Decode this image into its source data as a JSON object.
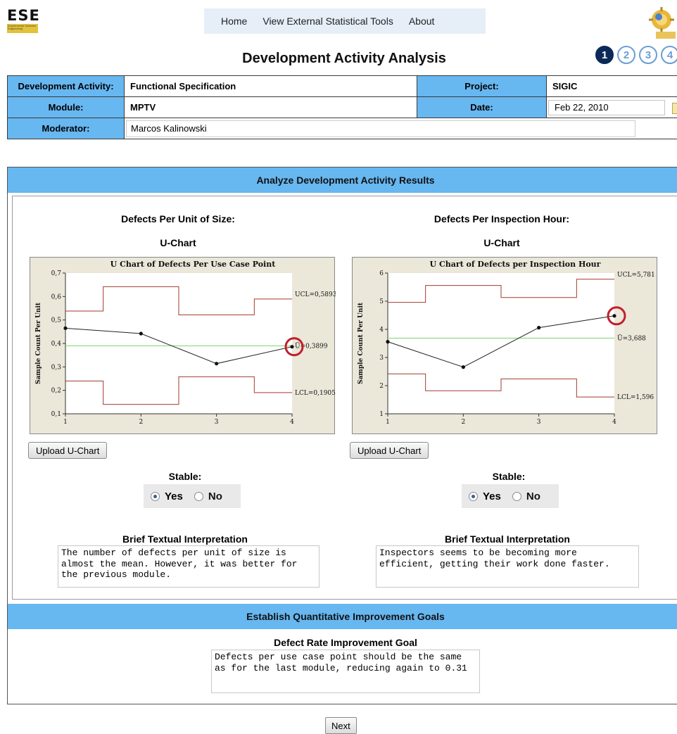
{
  "brand": {
    "logo_text": "ESE",
    "logo_subtext": "Experimental Software Engineering"
  },
  "nav": {
    "items": [
      "Home",
      "View External Statistical Tools",
      "About"
    ]
  },
  "page_title": "Development Activity Analysis",
  "steps": [
    "1",
    "2",
    "3",
    "4"
  ],
  "info": {
    "activity_label": "Development Activity:",
    "activity_value": "Functional Specification",
    "project_label": "Project:",
    "project_value": "SIGIC",
    "module_label": "Module:",
    "module_value": "MPTV",
    "date_label": "Date:",
    "date_value": "Feb 22, 2010",
    "moderator_label": "Moderator:",
    "moderator_value": "Marcos Kalinowski"
  },
  "analyze": {
    "header": "Analyze Development Activity Results",
    "left": {
      "title": "Defects Per Unit of Size:",
      "subtitle": "U-Chart",
      "upload_label": "Upload U-Chart",
      "stable_label": "Stable:",
      "yes_label": "Yes",
      "no_label": "No",
      "brief_label": "Brief Textual Interpretation",
      "brief_text": "The number of defects per unit of size is almost the mean. However, it was better for the previous module."
    },
    "right": {
      "title": "Defects Per Inspection Hour:",
      "subtitle": "U-Chart",
      "upload_label": "Upload U-Chart",
      "stable_label": "Stable:",
      "yes_label": "Yes",
      "no_label": "No",
      "brief_label": "Brief Textual Interpretation",
      "brief_text": "Inspectors seems to be becoming more efficient, getting their work done faster."
    }
  },
  "goals": {
    "header": "Establish Quantitative Improvement Goals",
    "label": "Defect Rate Improvement Goal",
    "text": "Defects per use case point should be the same as for the last module, reducing again to 0.31"
  },
  "next_label": "Next",
  "colors": {
    "header_blue": "#67b7f1",
    "limit_red": "#a33a2e",
    "center_green": "#7bd46a",
    "highlight_red": "#c0202c"
  },
  "chart_data": [
    {
      "type": "line",
      "title": "U Chart of Defects Per Use Case Point",
      "ylabel": "Sample Count Per Unit",
      "x": [
        1,
        2,
        3,
        4
      ],
      "values": [
        0.465,
        0.442,
        0.314,
        0.386
      ],
      "ylim": [
        0.1,
        0.7
      ],
      "yticks": [
        "0,1",
        "0,2",
        "0,3",
        "0,4",
        "0,5",
        "0,6",
        "0,7"
      ],
      "center": 0.3899,
      "ucl": [
        0.538,
        0.642,
        0.522,
        0.5893
      ],
      "lcl": [
        0.24,
        0.14,
        0.258,
        0.1905
      ],
      "labels": {
        "ucl": "UCL=0,5893",
        "center": "Ū=0,3899",
        "lcl": "LCL=0,1905"
      },
      "highlight_point": 4
    },
    {
      "type": "line",
      "title": "U Chart of Defects per Inspection Hour",
      "ylabel": "Sample Count Per Unit",
      "x": [
        1,
        2,
        3,
        4
      ],
      "values": [
        3.56,
        2.66,
        4.06,
        4.48
      ],
      "ylim": [
        1,
        6
      ],
      "yticks": [
        "1",
        "2",
        "3",
        "4",
        "5",
        "6"
      ],
      "center": 3.688,
      "ucl": [
        4.96,
        5.56,
        5.13,
        5.781
      ],
      "lcl": [
        2.42,
        1.82,
        2.24,
        1.596
      ],
      "labels": {
        "ucl": "UCL=5,781",
        "center": "Ū=3,688",
        "lcl": "LCL=1,596"
      },
      "highlight_point": 4
    }
  ]
}
